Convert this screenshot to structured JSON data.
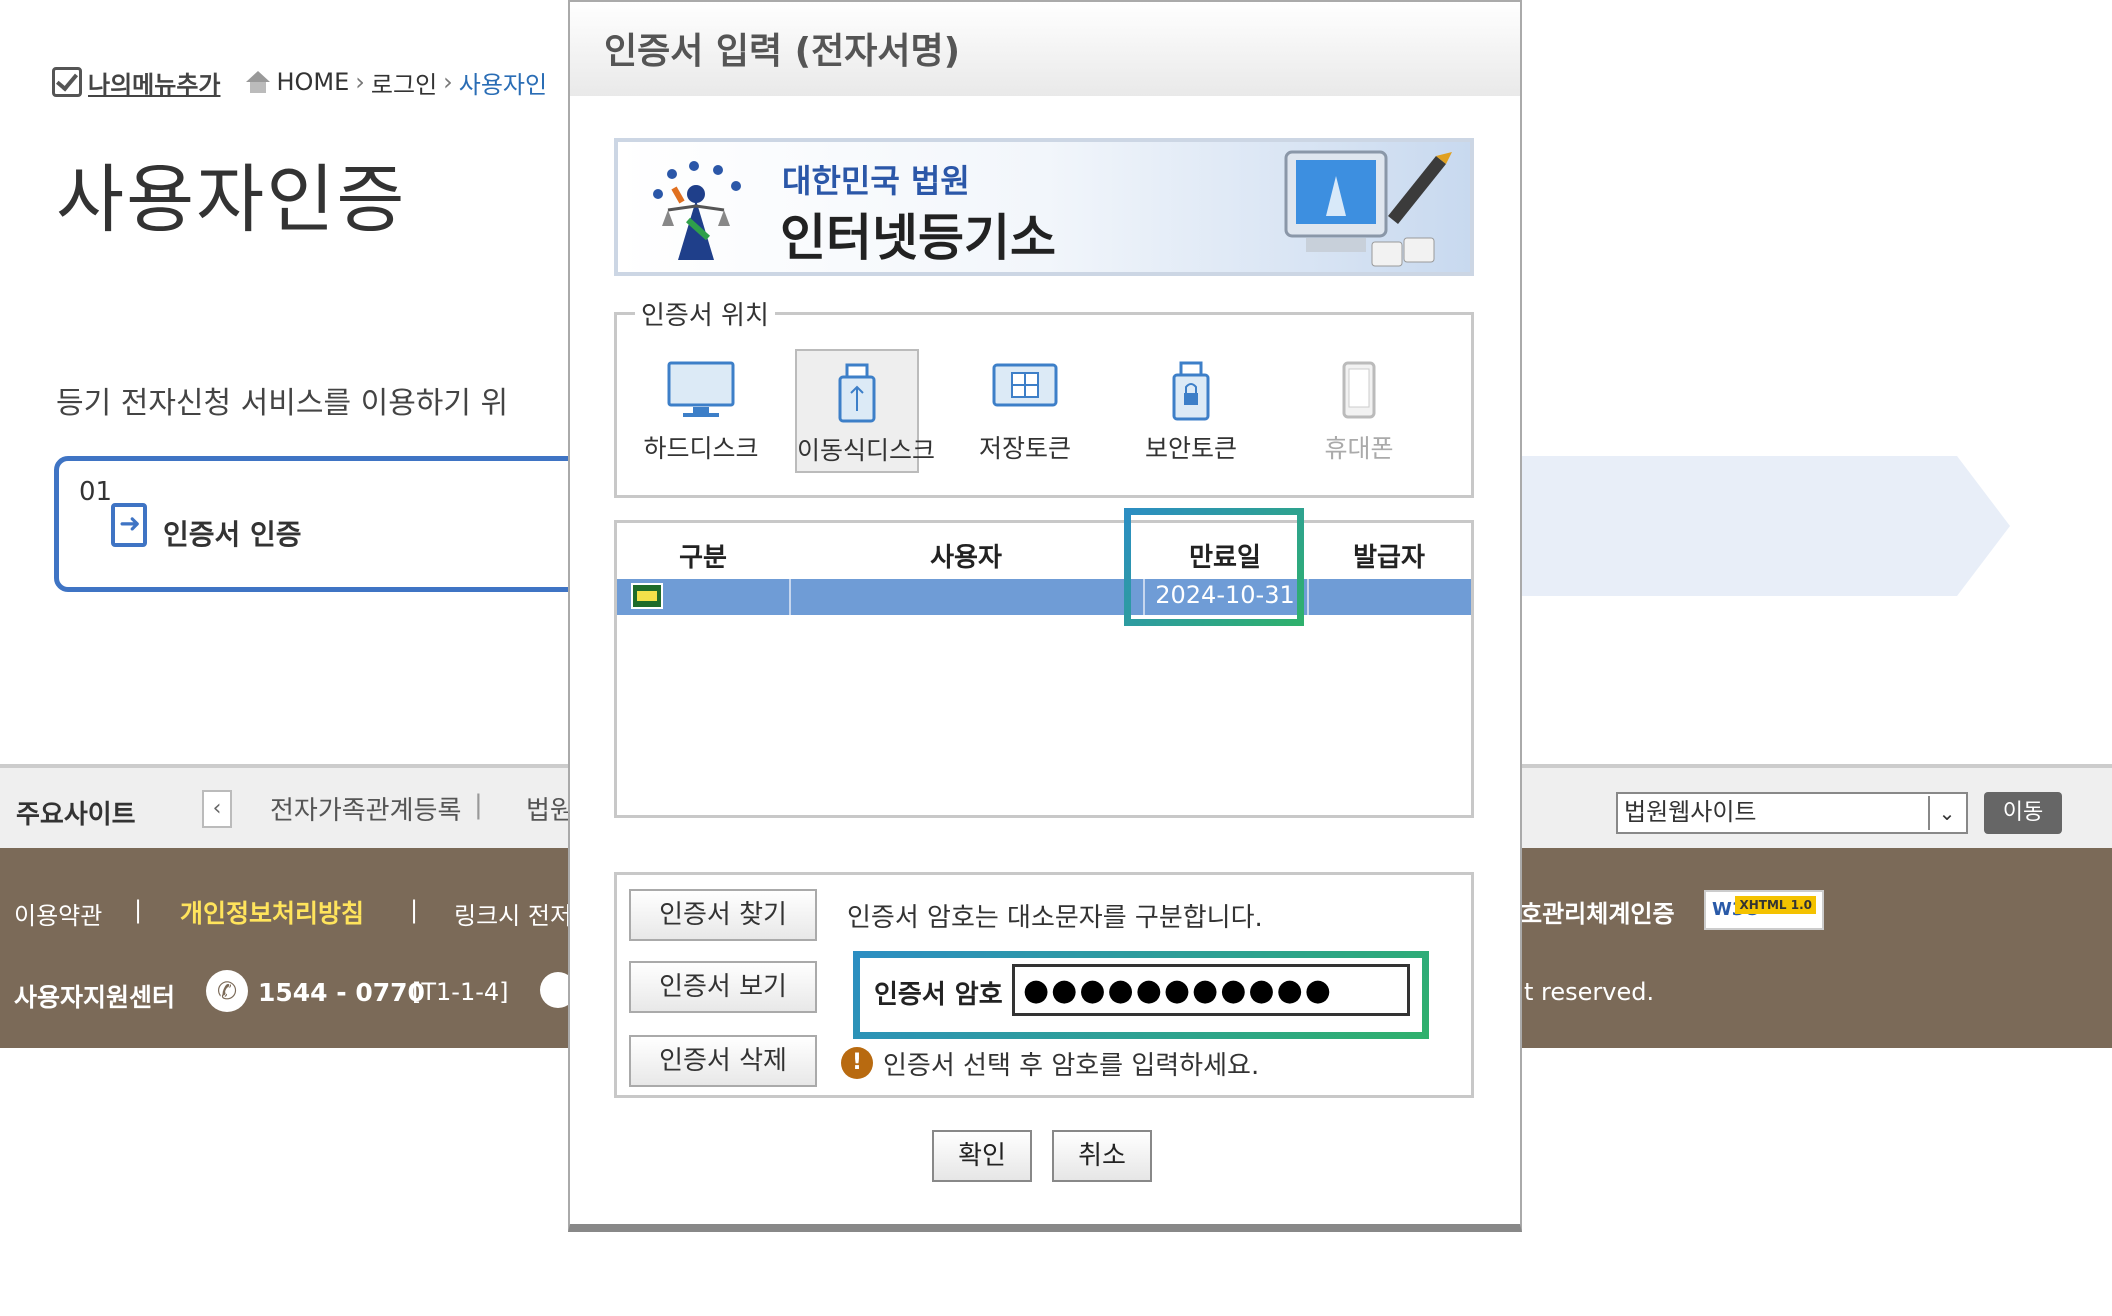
{
  "breadcrumb": {
    "my_menu_label": "나의메뉴추가",
    "home": "HOME",
    "login": "로그인",
    "current": "사용자인"
  },
  "page": {
    "title": "사용자인증",
    "description": "등기 전자신청 서비스를 이용하기 위",
    "step": {
      "number": "01",
      "label": "인증서 인증"
    }
  },
  "sites_bar": {
    "title": "주요사이트",
    "links": [
      "전자가족관계등록",
      "법원"
    ],
    "select_value": "법원웹사이트",
    "go_label": "이동"
  },
  "footer": {
    "terms": "이용약관",
    "privacy": "개인정보처리방침",
    "link": "링크시 전저",
    "support_center": "사용자지원센터",
    "phone": "1544 - 0770",
    "code": "[T1-1-4]",
    "cert_text": "호관리체계인증",
    "w3c_label": "W3C",
    "xhtml_label": "XHTML 1.0",
    "rights": "t reserved."
  },
  "dialog": {
    "title": "인증서 입력 (전자서명)",
    "banner": {
      "court": "대한민국 법원",
      "registry": "인터넷등기소"
    },
    "location": {
      "legend": "인증서 위치",
      "options": [
        {
          "label": "하드디스크",
          "icon": "monitor-icon",
          "selected": false
        },
        {
          "label": "이동식디스크",
          "icon": "usb-icon",
          "selected": true
        },
        {
          "label": "저장토큰",
          "icon": "token-icon",
          "selected": false
        },
        {
          "label": "보안토큰",
          "icon": "lock-token-icon",
          "selected": false
        },
        {
          "label": "휴대폰",
          "icon": "phone-icon",
          "selected": false,
          "disabled": true
        }
      ]
    },
    "table": {
      "headers": [
        "구분",
        "사용자",
        "만료일",
        "발급자"
      ],
      "rows": [
        {
          "type_icon": "certificate-icon",
          "user": "",
          "expiry": "2024-10-31",
          "issuer": ""
        }
      ]
    },
    "buttons": {
      "find": "인증서 찾기",
      "view": "인증서 보기",
      "delete": "인증서 삭제",
      "ok": "확인",
      "cancel": "취소"
    },
    "case_note": "인증서 암호는 대소문자를 구분합니다.",
    "password": {
      "label": "인증서 암호",
      "value": "●●●●●●●●●●●"
    },
    "warning": "인증서 선택 후 암호를 입력하세요."
  },
  "colors": {
    "accent_blue": "#3f74c4",
    "row_selected": "#6f9cd6",
    "footer_bg": "#7b6a58",
    "privacy_yellow": "#ffe45c",
    "highlight_gradient_start": "#2c8ec2",
    "highlight_gradient_end": "#2fb06d"
  }
}
